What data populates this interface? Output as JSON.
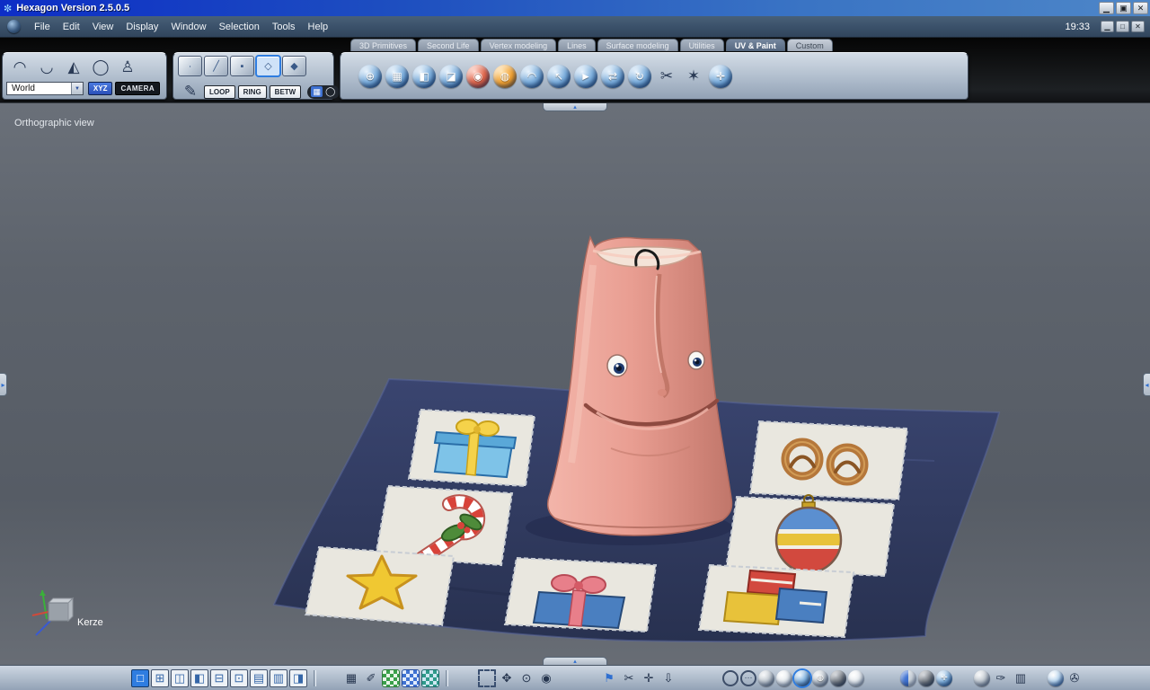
{
  "window": {
    "title": "Hexagon Version 2.5.0.5",
    "clock": "19:33"
  },
  "menubar": {
    "items": [
      "File",
      "Edit",
      "View",
      "Display",
      "Window",
      "Selection",
      "Tools",
      "Help"
    ]
  },
  "tabs": [
    {
      "label": "3D Primitives"
    },
    {
      "label": "Second Life"
    },
    {
      "label": "Vertex modeling"
    },
    {
      "label": "Lines"
    },
    {
      "label": "Surface modeling"
    },
    {
      "label": "Utilities"
    },
    {
      "label": "UV & Paint",
      "active": true
    },
    {
      "label": "Custom"
    }
  ],
  "toolbar": {
    "world_label": "World",
    "xyz_label": "XYZ",
    "camera_label": "CAMERA",
    "loop_label": "LOOP",
    "ring_label": "RING",
    "betw_label": "BETW"
  },
  "viewport": {
    "view_label": "Orthographic view",
    "object_label": "Kerze"
  },
  "ui_glyphs": {
    "app_icon": "✼",
    "dropdown_arrow": "▼",
    "collapse_arrow": "▴",
    "edge_left_arrow": "▸",
    "edge_right_arrow": "◂",
    "titlebar_minimize": "▁",
    "titlebar_restore": "▣",
    "titlebar_close": "✕",
    "menubar_minimize": "▁",
    "menubar_maximize": "□",
    "menubar_close": "✕"
  },
  "colors": {
    "accent_blue": "#2f7de0",
    "candle_pink": "#e89d94",
    "quilt_navy": "#323d63",
    "titlebar_blue": "#0d2ec6"
  },
  "icons": {
    "select_tools": [
      {
        "name": "soft-selection-icon",
        "kind": "flat",
        "glyph": "◠"
      },
      {
        "name": "lasso-selection-icon",
        "kind": "flat",
        "glyph": "◡"
      },
      {
        "name": "cone-selection-icon",
        "kind": "flat",
        "glyph": "◭"
      },
      {
        "name": "ring-selection-icon",
        "kind": "flat",
        "glyph": "◯"
      },
      {
        "name": "ghost-magnet-icon",
        "kind": "flat",
        "glyph": "♙"
      }
    ],
    "selection_cubes": [
      {
        "name": "vertex-mode-cube-icon",
        "kind": "cube",
        "glyph": "∙"
      },
      {
        "name": "edge-mode-cube-icon",
        "kind": "cube",
        "glyph": "╱"
      },
      {
        "name": "face-mode-cube-icon",
        "kind": "cube",
        "glyph": "▪"
      },
      {
        "name": "loop-mode-cube-icon",
        "kind": "cube",
        "glyph": "◇",
        "active": true
      },
      {
        "name": "object-mode-cube-icon",
        "kind": "cube",
        "glyph": "◆"
      }
    ],
    "edge_tool": [
      {
        "name": "edge-pen-icon",
        "kind": "flat",
        "glyph": "✎"
      }
    ],
    "betw_extra": [
      {
        "name": "betw-checker-icon",
        "kind": "mini-blue",
        "glyph": "▦"
      },
      {
        "name": "betw-circle-icon",
        "kind": "mini-ring",
        "glyph": "◯"
      }
    ],
    "uv_tools": [
      {
        "name": "uv-globe-icon",
        "kind": "sphere",
        "glyph": "⊕"
      },
      {
        "name": "uv-checker-sphere-icon",
        "kind": "sphere",
        "glyph": "▦"
      },
      {
        "name": "uv-checker-corner-icon",
        "kind": "sphere",
        "glyph": "◧"
      },
      {
        "name": "uv-box-projection-icon",
        "kind": "sphere",
        "glyph": "◪"
      },
      {
        "name": "uv-material-sphere-icon",
        "kind": "sphere-red",
        "glyph": "◉"
      },
      {
        "name": "uv-texture-sphere-icon",
        "kind": "sphere-orange",
        "glyph": "◍"
      },
      {
        "name": "uv-lasso-sphere-icon",
        "kind": "sphere",
        "glyph": "◠"
      },
      {
        "name": "uv-drag-sphere-icon",
        "kind": "sphere",
        "glyph": "↖"
      },
      {
        "name": "uv-select-sphere-icon",
        "kind": "sphere",
        "glyph": "►"
      },
      {
        "name": "uv-mirror-icon",
        "kind": "sphere",
        "glyph": "⇄"
      },
      {
        "name": "uv-rotate-icon",
        "kind": "sphere",
        "glyph": "↻"
      },
      {
        "name": "uv-knife-icon",
        "kind": "flat",
        "glyph": "✂"
      },
      {
        "name": "uv-fan-icon",
        "kind": "flat",
        "glyph": "✶"
      },
      {
        "name": "uv-pin-icon",
        "kind": "sphere",
        "glyph": "✛"
      }
    ],
    "bottom_layouts": [
      {
        "name": "layout-single-icon",
        "kind": "layout",
        "glyph": "□",
        "active": true
      },
      {
        "name": "layout-quad-icon",
        "kind": "layout",
        "glyph": "⊞"
      },
      {
        "name": "layout-right-split-icon",
        "kind": "layout",
        "glyph": "◫"
      },
      {
        "name": "layout-left-split-icon",
        "kind": "layout",
        "glyph": "◧"
      },
      {
        "name": "layout-bottom-split-icon",
        "kind": "layout",
        "glyph": "⊟"
      },
      {
        "name": "layout-top-split-icon",
        "kind": "layout",
        "glyph": "⊡"
      },
      {
        "name": "layout-rows-icon",
        "kind": "layout",
        "glyph": "▤"
      },
      {
        "name": "layout-columns-icon",
        "kind": "layout",
        "glyph": "▥"
      },
      {
        "name": "layout-two-columns-icon",
        "kind": "layout",
        "glyph": "◨"
      }
    ],
    "bottom_materials": [
      {
        "name": "uvmap-grid-icon",
        "kind": "flat",
        "glyph": "▦"
      },
      {
        "name": "paintbrush-icon",
        "kind": "flat",
        "glyph": "✐"
      },
      {
        "name": "checker-green-icon",
        "kind": "grid-green"
      },
      {
        "name": "checker-blue-icon",
        "kind": "grid-blue"
      },
      {
        "name": "checker-teal-icon",
        "kind": "grid-teal"
      }
    ],
    "bottom_view": [
      {
        "name": "marquee-select-icon",
        "kind": "dashed"
      },
      {
        "name": "pan-icon",
        "kind": "flat",
        "glyph": "✥"
      },
      {
        "name": "zoom-icon",
        "kind": "flat",
        "glyph": "⊙"
      },
      {
        "name": "visibility-eye-icon",
        "kind": "flat",
        "glyph": "◉"
      }
    ],
    "bottom_uvpaint": [
      {
        "name": "uv-flag-icon",
        "kind": "flat-blue",
        "glyph": "⚑"
      },
      {
        "name": "uv-scissors-icon",
        "kind": "flat",
        "glyph": "✂"
      },
      {
        "name": "uv-anchor-icon",
        "kind": "flat",
        "glyph": "✛"
      },
      {
        "name": "uv-drop-icon",
        "kind": "flat",
        "glyph": "⇩"
      }
    ],
    "bottom_shading": [
      {
        "name": "shade-wire-sphere-icon",
        "kind": "sphere-wire"
      },
      {
        "name": "shade-points-sphere-icon",
        "kind": "sphere-wire",
        "glyph": "⋯"
      },
      {
        "name": "shade-flat-sphere-icon",
        "kind": "sphere-gray"
      },
      {
        "name": "shade-smooth-sphere-icon",
        "kind": "sphere-light"
      },
      {
        "name": "shade-textured-sphere-icon",
        "kind": "sphere",
        "active": true
      },
      {
        "name": "shade-wireshade-sphere-icon",
        "kind": "sphere-gray",
        "glyph": "◍"
      },
      {
        "name": "shade-matte-sphere-icon",
        "kind": "sphere-dark"
      },
      {
        "name": "shade-glossy-sphere-icon",
        "kind": "sphere-light"
      }
    ],
    "bottom_visibility": [
      {
        "name": "backface-sphere-icon",
        "kind": "sphere-half"
      },
      {
        "name": "ghost-sphere-icon",
        "kind": "sphere-dark"
      },
      {
        "name": "axes-sphere-icon",
        "kind": "sphere",
        "glyph": "✛"
      }
    ],
    "bottom_panels": [
      {
        "name": "light-sphere-icon",
        "kind": "sphere-gray"
      },
      {
        "name": "pen-tool-icon",
        "kind": "flat",
        "glyph": "✑"
      },
      {
        "name": "split-panel-icon",
        "kind": "flat",
        "glyph": "▥"
      }
    ],
    "bottom_render": [
      {
        "name": "render-sphere-icon",
        "kind": "sphere-shine"
      },
      {
        "name": "snapshot-camera-icon",
        "kind": "flat",
        "glyph": "✇"
      }
    ]
  }
}
